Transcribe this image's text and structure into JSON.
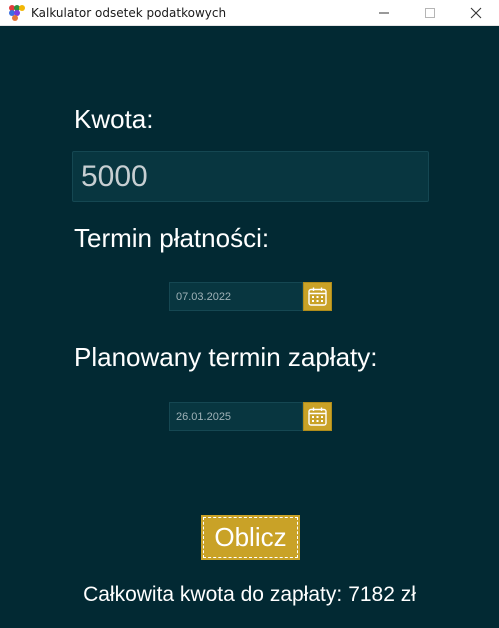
{
  "window": {
    "title": "Kalkulator odsetek podatkowych",
    "controls": [
      "minimize",
      "maximize",
      "close"
    ]
  },
  "form": {
    "amount_label": "Kwota:",
    "amount_value": "5000",
    "due_date_label": "Termin płatności:",
    "due_date_value": "07.03.2022",
    "planned_date_label": "Planowany termin zapłaty:",
    "planned_date_value": "26.01.2025",
    "calculate_label": "Oblicz"
  },
  "result": {
    "label": "Całkowita kwota do zapłaty:",
    "value": "7182 zł"
  },
  "colors": {
    "background": "#022933",
    "accent": "#c9a227",
    "input_background": "#083640",
    "text": "#ffffff"
  }
}
